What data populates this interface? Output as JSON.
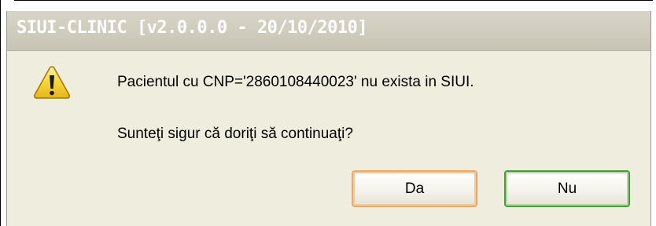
{
  "dialog": {
    "title": "SIUI-CLINIC [v2.0.0.0 - 20/10/2010]",
    "icon": "warning-icon",
    "message_line1": "Pacientul cu CNP='2860108440023' nu exista in SIUI.",
    "message_line2": "Sunteţi sigur că doriţi să continuaţi?",
    "buttons": {
      "yes_label": "Da",
      "no_label": "Nu"
    }
  },
  "colors": {
    "dialog_bg": "#efedde",
    "titlebar_text": "#ffffff",
    "warning_yellow": "#f7d63c",
    "default_button_border": "#e9a96a",
    "button_border_green": "#4a9a3c"
  }
}
